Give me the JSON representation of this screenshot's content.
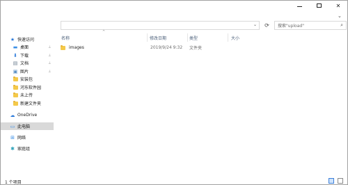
{
  "window": {
    "controls": {
      "minimize": "",
      "maximize": "",
      "close": "✕"
    }
  },
  "address": {
    "refresh_glyph": "⟳",
    "dropdown_glyph": "⌄",
    "search_placeholder": "搜索\"upload\"",
    "search_icon": "⌕"
  },
  "ribbon": {
    "expand_glyph": "⌄"
  },
  "nav": {
    "items": [
      {
        "label": "快速访问",
        "icon": "star-icon",
        "glyph": "★",
        "color": "#2b79d9",
        "pinned": false
      },
      {
        "label": "桌面",
        "icon": "desktop-icon",
        "glyph": "▬",
        "color": "#3a8ee6",
        "pinned": true
      },
      {
        "label": "下载",
        "icon": "download-icon",
        "glyph": "⬇",
        "color": "#2b79d9",
        "pinned": true
      },
      {
        "label": "文档",
        "icon": "document-icon",
        "glyph": "▤",
        "color": "#6d7d8f",
        "pinned": true
      },
      {
        "label": "图片",
        "icon": "pictures-icon",
        "glyph": "▣",
        "color": "#5a8fc5",
        "pinned": true
      },
      {
        "label": "安装包",
        "icon": "folder-icon",
        "glyph": "",
        "color": "#f4c94a",
        "pinned": false
      },
      {
        "label": "河东软件园",
        "icon": "folder-icon",
        "glyph": "",
        "color": "#f4c94a",
        "pinned": false
      },
      {
        "label": "未上传",
        "icon": "folder-icon",
        "glyph": "",
        "color": "#f4c94a",
        "pinned": false
      },
      {
        "label": "新建文件夹",
        "icon": "folder-icon",
        "glyph": "",
        "color": "#f4c94a",
        "pinned": false
      },
      {
        "label": "OneDrive",
        "icon": "onedrive-icon",
        "glyph": "☁",
        "color": "#2b79d9",
        "pinned": false
      },
      {
        "label": "此电脑",
        "icon": "computer-icon",
        "glyph": "▭",
        "color": "#3a8ee6",
        "pinned": false,
        "selected": true
      },
      {
        "label": "网络",
        "icon": "network-icon",
        "glyph": "⊞",
        "color": "#3a8ee6",
        "pinned": false
      },
      {
        "label": "家庭组",
        "icon": "homegroup-icon",
        "glyph": "✱",
        "color": "#2aa0b8",
        "pinned": false
      }
    ],
    "pin_glyph": "📌"
  },
  "columns": {
    "name": "名称",
    "date": "修改日期",
    "type": "类型",
    "size": "大小",
    "sort_glyph": "^"
  },
  "files": [
    {
      "name": "images",
      "date": "2019/9/24 9:32",
      "type": "文件夹",
      "size": ""
    }
  ],
  "status": {
    "count": "1 个项目"
  }
}
